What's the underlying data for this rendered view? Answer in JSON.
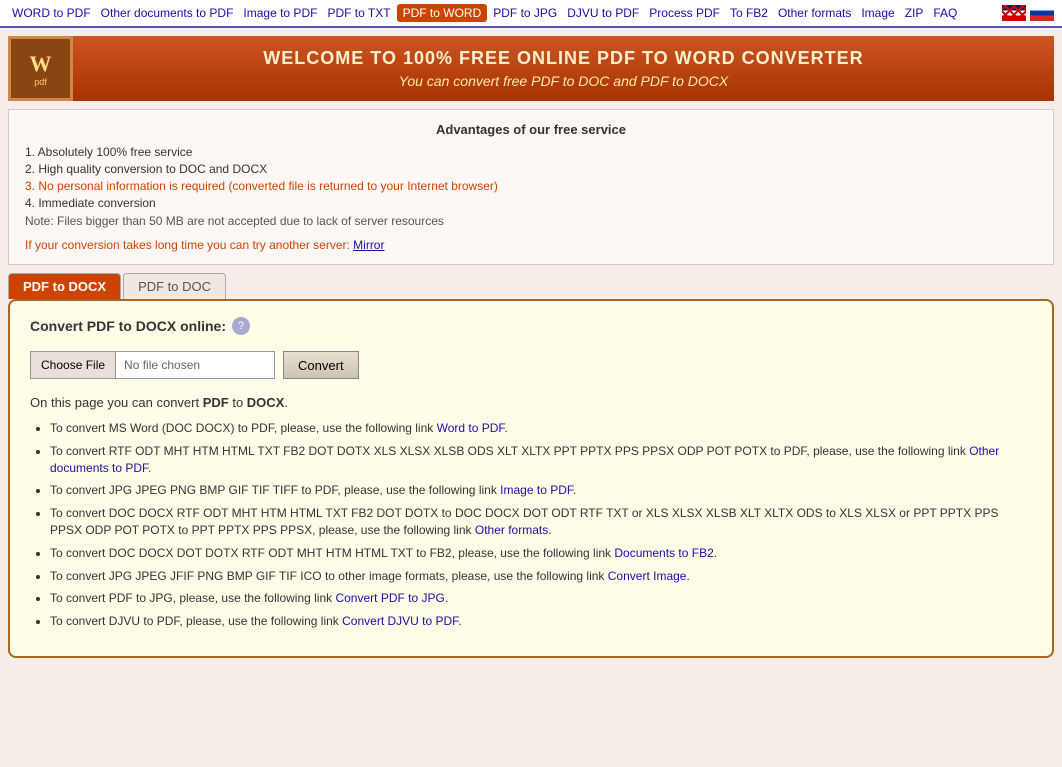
{
  "nav": {
    "links": [
      {
        "label": "WORD to PDF",
        "active": false,
        "id": "word-to-pdf"
      },
      {
        "label": "Other documents to PDF",
        "active": false,
        "id": "other-docs-to-pdf"
      },
      {
        "label": "Image to PDF",
        "active": false,
        "id": "image-to-pdf"
      },
      {
        "label": "PDF to TXT",
        "active": false,
        "id": "pdf-to-txt"
      },
      {
        "label": "PDF to WORD",
        "active": true,
        "id": "pdf-to-word"
      },
      {
        "label": "PDF to JPG",
        "active": false,
        "id": "pdf-to-jpg"
      },
      {
        "label": "DJVU to PDF",
        "active": false,
        "id": "djvu-to-pdf"
      },
      {
        "label": "Process PDF",
        "active": false,
        "id": "process-pdf"
      },
      {
        "label": "To FB2",
        "active": false,
        "id": "to-fb2"
      },
      {
        "label": "Other formats",
        "active": false,
        "id": "other-formats"
      },
      {
        "label": "Image",
        "active": false,
        "id": "image"
      },
      {
        "label": "ZIP",
        "active": false,
        "id": "zip"
      },
      {
        "label": "FAQ",
        "active": false,
        "id": "faq"
      }
    ]
  },
  "header": {
    "logo_text": "W",
    "logo_sub": "pdf",
    "title": "WELCOME TO 100% FREE ONLINE PDF TO WORD CONVERTER",
    "subtitle": "You can convert free PDF to DOC and PDF to DOCX"
  },
  "advantages": {
    "title": "Advantages of our free service",
    "items": [
      {
        "text": "1. Absolutely 100% free service",
        "highlight": false
      },
      {
        "text": "2. High quality conversion to DOC and DOCX",
        "highlight": false
      },
      {
        "text": "3. No personal information is required (converted file is returned to your Internet browser)",
        "highlight": true
      },
      {
        "text": "4. Immediate conversion",
        "highlight": false
      }
    ],
    "note": "Note: Files bigger than 50 MB are not accepted due to lack of server resources",
    "mirror_text": "If your conversion takes long time you can try another server: ",
    "mirror_link": "Mirror"
  },
  "tabs": [
    {
      "label": "PDF to DOCX",
      "active": true
    },
    {
      "label": "PDF to DOC",
      "active": false
    }
  ],
  "converter": {
    "label": "Convert PDF to DOCX online:",
    "choose_file_label": "Choose File",
    "no_file_label": "No file chosen",
    "convert_label": "Convert",
    "info_text": "On this page you can convert PDF to DOCX.",
    "bullet_items": [
      {
        "text_before": "To convert MS Word (DOC DOCX) to PDF, please, use the following link ",
        "link_text": "Word to PDF",
        "text_after": "."
      },
      {
        "text_before": "To convert RTF ODT MHT HTM HTML TXT FB2 DOT DOTX XLS XLSX XLSB ODS XLT XLTX PPT PPTX PPS PPSX ODP POT POTX to PDF, please, use the following link ",
        "link_text": "Other documents to PDF",
        "text_after": "."
      },
      {
        "text_before": "To convert JPG JPEG PNG BMP GIF TIF TIFF to PDF, please, use the following link ",
        "link_text": "Image to PDF",
        "text_after": "."
      },
      {
        "text_before": "To convert DOC DOCX RTF ODT MHT HTM HTML TXT FB2 DOT DOTX to DOC DOCX DOT ODT RTF TXT or XLS XLSX XLSB XLT XLTX ODS to XLS XLSX or PPT PPTX PPS PPSX ODP POT POTX to PPT PPTX PPS PPSX, please, use the following link ",
        "link_text": "Other formats",
        "text_after": "."
      },
      {
        "text_before": "To convert DOC DOCX DOT DOTX RTF ODT MHT HTM HTML TXT to FB2, please, use the following link ",
        "link_text": "Documents to FB2",
        "text_after": "."
      },
      {
        "text_before": "To convert JPG JPEG JFIF PNG BMP GIF TIF ICO to other image formats, please, use the following link ",
        "link_text": "Convert Image",
        "text_after": "."
      },
      {
        "text_before": "To convert PDF to JPG, please, use the following link ",
        "link_text": "Convert PDF to JPG",
        "text_after": "."
      },
      {
        "text_before": "To convert DJVU to PDF, please, use the following link ",
        "link_text": "Convert DJVU to PDF",
        "text_after": "."
      }
    ]
  }
}
